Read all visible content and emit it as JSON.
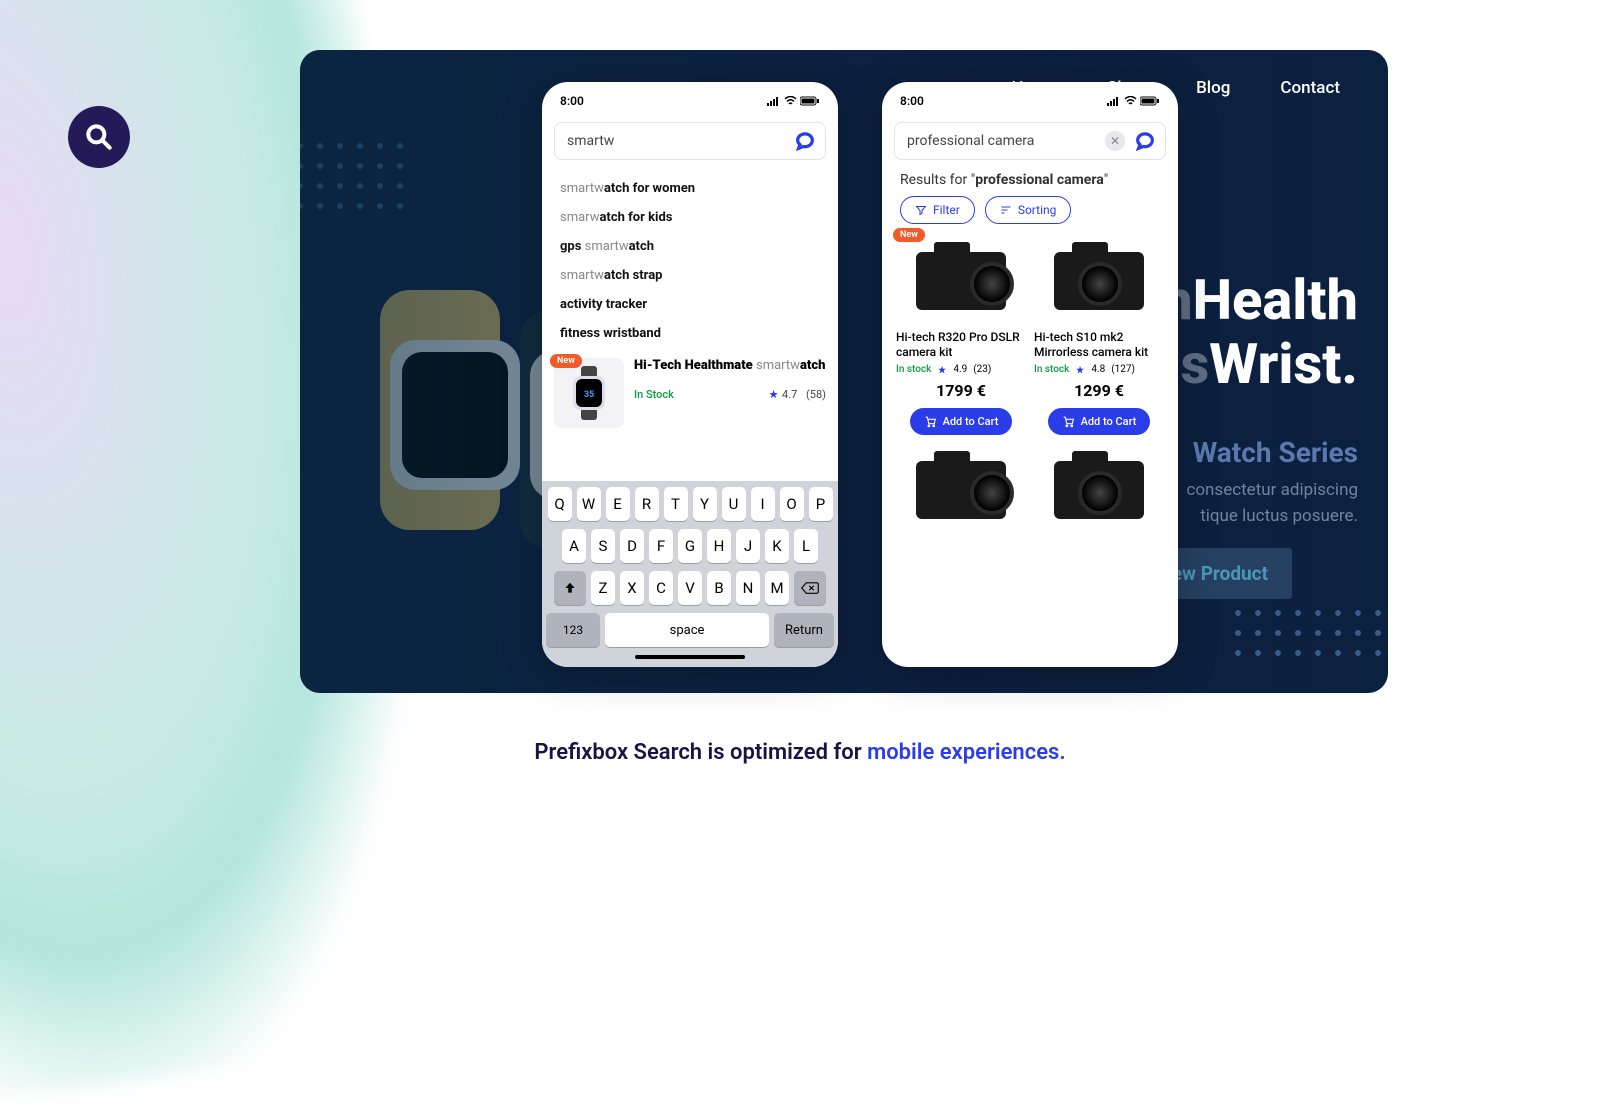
{
  "logo_name": "prefixbox",
  "card": {
    "nav": [
      "Home",
      "Shop",
      "Blog",
      "Contact"
    ],
    "hero_line1": "Health",
    "hero_line2": "Wrist.",
    "hero_line1_pre": "Th",
    "hero_line2_pre": "is",
    "subtitle": "Watch Series",
    "body_line1": "consectetur adipiscing",
    "body_line2": "tique luctus posuere.",
    "view_btn": "View Product"
  },
  "phone1": {
    "time": "8:00",
    "search_value": "smartw",
    "suggestions": [
      {
        "pre": "smartw",
        "bold": "atch for women"
      },
      {
        "pre": "smarw",
        "bold": "atch for kids"
      },
      {
        "pre_bold": "gps ",
        "mid": "smartw",
        "bold": "atch"
      },
      {
        "pre": "smartw",
        "bold": "atch strap"
      },
      {
        "bold_full": "activity tracker"
      },
      {
        "bold_full": "fitness wristband"
      }
    ],
    "product": {
      "new": "New",
      "title_bold": "Hi-Tech Healthmate",
      "title_light": " smartw",
      "title_bold2": "atch",
      "stock": "In Stock",
      "rating": "4.7",
      "reviews": "(58)"
    },
    "keyboard": {
      "row1": [
        "Q",
        "W",
        "E",
        "R",
        "T",
        "Y",
        "U",
        "I",
        "O",
        "P"
      ],
      "row2": [
        "A",
        "S",
        "D",
        "F",
        "G",
        "H",
        "J",
        "K",
        "L"
      ],
      "row3": [
        "Z",
        "X",
        "C",
        "V",
        "B",
        "N",
        "M"
      ],
      "sys": "123",
      "space": "space",
      "ret": "Return"
    }
  },
  "phone2": {
    "time": "8:00",
    "search_value": "professional camera",
    "results_prefix": "Results for \"",
    "results_query": "professional camera",
    "results_suffix": "\"",
    "filter": "Filter",
    "sorting": "Sorting",
    "products": [
      {
        "new": "New",
        "title": "Hi-tech R320 Pro DSLR camera kit",
        "stock": "In stock",
        "rating": "4.9",
        "reviews": "(23)",
        "price": "1799 €",
        "cart": "Add to Cart"
      },
      {
        "title": "Hi-tech S10 mk2 Mirrorless camera kit",
        "stock": "In stock",
        "rating": "4.8",
        "reviews": "(127)",
        "price": "1299 €",
        "cart": "Add to Cart"
      }
    ]
  },
  "tagline": {
    "a": "Prefixbox Search is optimized for ",
    "b": "mobile experiences."
  }
}
